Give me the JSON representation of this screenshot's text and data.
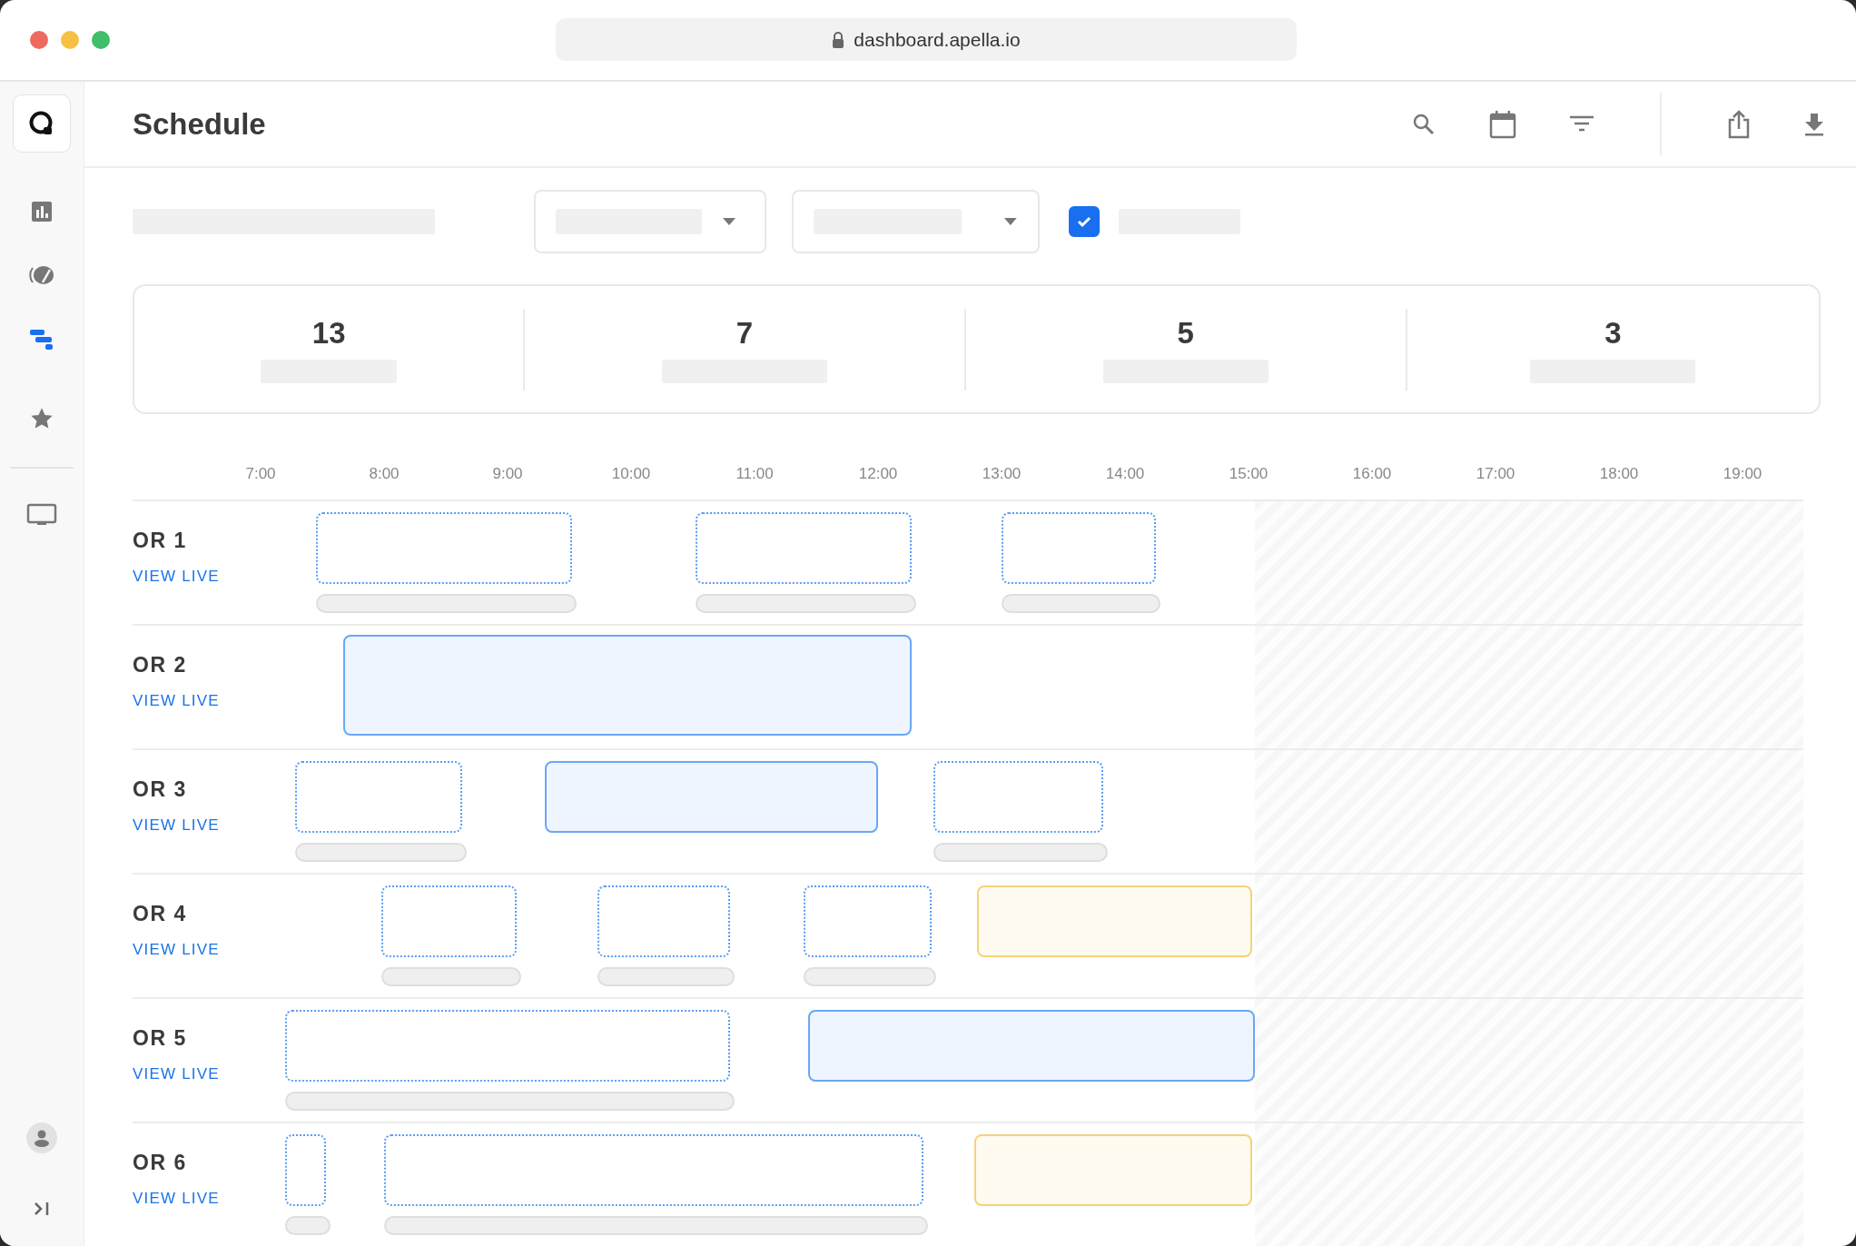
{
  "browser": {
    "url": "dashboard.apella.io"
  },
  "sidebar": {
    "items": [
      {
        "selected": false
      },
      {
        "selected": false
      },
      {
        "selected": true
      },
      {
        "selected": false
      },
      {
        "selected": false
      }
    ]
  },
  "header": {
    "title": "Schedule"
  },
  "filters": {
    "checkbox": {
      "checked": true
    }
  },
  "stats": [
    {
      "value": "13"
    },
    {
      "value": "7"
    },
    {
      "value": "5"
    },
    {
      "value": "3"
    }
  ],
  "timeline": {
    "hours": [
      "7:00",
      "8:00",
      "9:00",
      "10:00",
      "11:00",
      "12:00",
      "13:00",
      "14:00",
      "15:00",
      "16:00",
      "17:00",
      "18:00",
      "19:00"
    ],
    "rows": [
      {
        "name": "OR 1",
        "link": "VIEW LIVE",
        "blocks": [
          {
            "kind": "planned"
          },
          {
            "kind": "planned"
          },
          {
            "kind": "planned"
          }
        ]
      },
      {
        "name": "OR 2",
        "link": "VIEW LIVE",
        "blocks": [
          {
            "kind": "active"
          }
        ]
      },
      {
        "name": "OR 3",
        "link": "VIEW LIVE",
        "blocks": [
          {
            "kind": "planned"
          },
          {
            "kind": "active"
          },
          {
            "kind": "planned"
          }
        ]
      },
      {
        "name": "OR 4",
        "link": "VIEW LIVE",
        "blocks": [
          {
            "kind": "planned"
          },
          {
            "kind": "planned"
          },
          {
            "kind": "planned"
          },
          {
            "kind": "pending"
          }
        ]
      },
      {
        "name": "OR 5",
        "link": "VIEW LIVE",
        "blocks": [
          {
            "kind": "planned"
          },
          {
            "kind": "active"
          }
        ]
      },
      {
        "name": "OR 6",
        "link": "VIEW LIVE",
        "blocks": [
          {
            "kind": "planned"
          },
          {
            "kind": "planned"
          },
          {
            "kind": "pending"
          }
        ]
      }
    ]
  }
}
